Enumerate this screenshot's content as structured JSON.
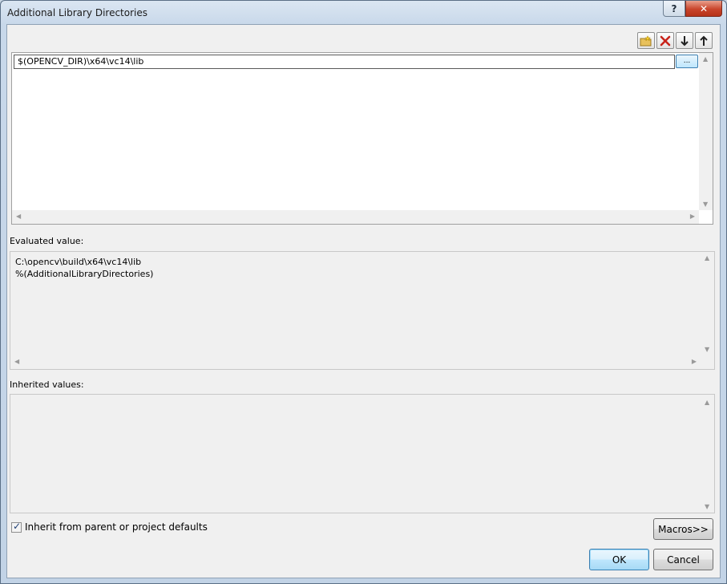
{
  "window": {
    "title": "Additional Library Directories",
    "help_label": "?",
    "close_label": "✕"
  },
  "toolbar": {
    "new_line_icon": "folder-new-icon",
    "delete_icon": "delete-icon",
    "move_down_icon": "arrow-down-icon",
    "move_up_icon": "arrow-up-icon"
  },
  "directories": {
    "items": [
      "$(OPENCV_DIR)\\x64\\vc14\\lib"
    ],
    "browse_label": "..."
  },
  "evaluated": {
    "label": "Evaluated value:",
    "lines": [
      "C:\\opencv\\build\\x64\\vc14\\lib",
      "%(AdditionalLibraryDirectories)"
    ]
  },
  "inherited": {
    "label": "Inherited values:"
  },
  "inherit_checkbox": {
    "label": "Inherit from parent or project defaults",
    "checked": true
  },
  "buttons": {
    "macros": "Macros>>",
    "ok": "OK",
    "cancel": "Cancel"
  }
}
